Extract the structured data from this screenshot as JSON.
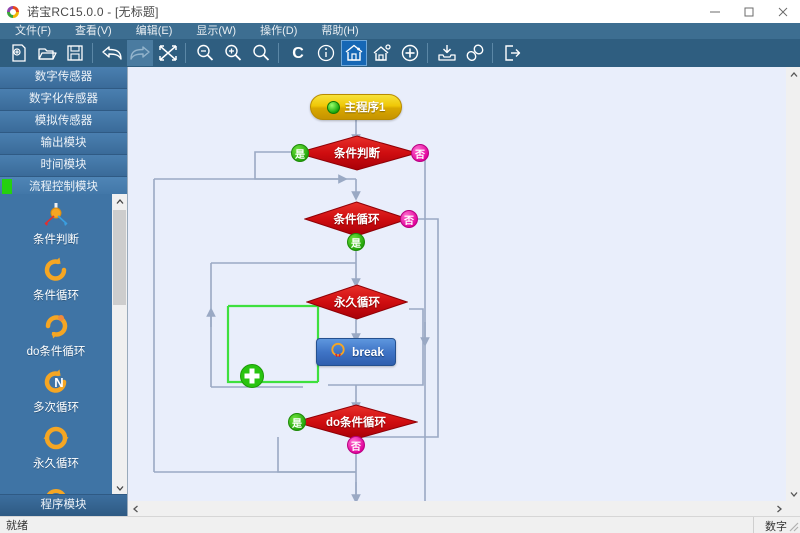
{
  "window": {
    "title": "诺宝RC15.0.0 - [无标题]",
    "logo_icon": "nobook-logo-icon",
    "minimize_icon": "minimize-icon",
    "maximize_icon": "maximize-icon",
    "close_icon": "close-icon"
  },
  "menubar": {
    "items": [
      {
        "label": "文件(F)",
        "name": "menu-file"
      },
      {
        "label": "查看(V)",
        "name": "menu-view"
      },
      {
        "label": "编辑(E)",
        "name": "menu-edit"
      },
      {
        "label": "显示(W)",
        "name": "menu-display"
      },
      {
        "label": "操作(D)",
        "name": "menu-operate"
      },
      {
        "label": "帮助(H)",
        "name": "menu-help"
      }
    ]
  },
  "toolbar": {
    "buttons": [
      {
        "icon": "new-file-icon",
        "label": "新建"
      },
      {
        "icon": "open-folder-icon",
        "label": "打开"
      },
      {
        "icon": "save-disk-icon",
        "label": "保存"
      },
      {
        "icon": "undo-arrow-icon",
        "label": "撤销"
      },
      {
        "icon": "redo-arrow-icon",
        "label": "重做"
      },
      {
        "icon": "delete-x-icon",
        "label": "删除"
      },
      {
        "icon": "zoom-out-icon",
        "label": "缩小"
      },
      {
        "icon": "zoom-in-icon",
        "label": "放大"
      },
      {
        "icon": "zoom-reset-icon",
        "label": "原始大小"
      },
      {
        "icon": "compile-c-icon",
        "label": "编译"
      },
      {
        "icon": "info-circle-icon",
        "label": "信息"
      },
      {
        "icon": "home-house-icon",
        "label": "主程序",
        "active": true
      },
      {
        "icon": "house-tag-icon",
        "label": "子程序"
      },
      {
        "icon": "plus-circle-icon",
        "label": "添加"
      },
      {
        "icon": "download-tray-icon",
        "label": "下载"
      },
      {
        "icon": "link-chain-icon",
        "label": "连接"
      },
      {
        "icon": "exit-door-icon",
        "label": "退出"
      }
    ]
  },
  "sidebar": {
    "categories": [
      {
        "label": "数字传感器",
        "selected": false
      },
      {
        "label": "数字化传感器",
        "selected": false
      },
      {
        "label": "模拟传感器",
        "selected": false
      },
      {
        "label": "输出模块",
        "selected": false
      },
      {
        "label": "时间模块",
        "selected": false
      },
      {
        "label": "流程控制模块",
        "selected": true
      }
    ],
    "palette_items": [
      {
        "label": "条件判断",
        "icon": "condition-branch-icon"
      },
      {
        "label": "条件循环",
        "icon": "while-loop-icon"
      },
      {
        "label": "do条件循环",
        "icon": "do-while-loop-icon"
      },
      {
        "label": "多次循环",
        "icon": "n-times-loop-icon"
      },
      {
        "label": "永久循环",
        "icon": "forever-loop-icon"
      },
      {
        "label": "",
        "icon": "break-loop-icon"
      }
    ],
    "bottom_category": {
      "label": "程序模块"
    },
    "scroll_up_icon": "chevron-up-icon",
    "scroll_down_icon": "chevron-down-icon"
  },
  "canvas": {
    "nodes": [
      {
        "id": "start",
        "type": "start",
        "label": "主程序1"
      },
      {
        "id": "cond1",
        "type": "decision",
        "label": "条件判断",
        "yes": "是",
        "no": "否"
      },
      {
        "id": "while1",
        "type": "decision",
        "label": "条件循环",
        "yes": "是",
        "no": "否"
      },
      {
        "id": "forever1",
        "type": "decision",
        "label": "永久循环"
      },
      {
        "id": "break1",
        "type": "action",
        "label": "break",
        "icon": "break-loop-icon"
      },
      {
        "id": "dowhile1",
        "type": "decision",
        "label": "do条件循环",
        "yes": "是",
        "no": "否"
      }
    ],
    "add_button": {
      "icon": "add-plus-icon",
      "label": "+"
    },
    "scroll_up_icon": "chevron-up-icon",
    "scroll_down_icon": "chevron-down-icon",
    "scroll_left_icon": "chevron-left-icon",
    "scroll_right_icon": "chevron-right-icon"
  },
  "statusbar": {
    "message": "就绪",
    "mode": "数字"
  },
  "colors": {
    "titlebar_bg": "#ffffff",
    "menubar_bg": "#3d6e91",
    "toolbar_bg": "#2f5e80",
    "sidebar_bg": "#3f74a5",
    "canvas_bg": "#e9eefb",
    "decision_red": "#d10f12",
    "start_yellow": "#efc707",
    "action_blue": "#3f74c6",
    "yes_green": "#21a309",
    "no_magenta": "#e0009a",
    "highlight_green": "#3ee03e",
    "connector_gray": "#9aa9c4",
    "active_toolbar": "#1667b5"
  }
}
